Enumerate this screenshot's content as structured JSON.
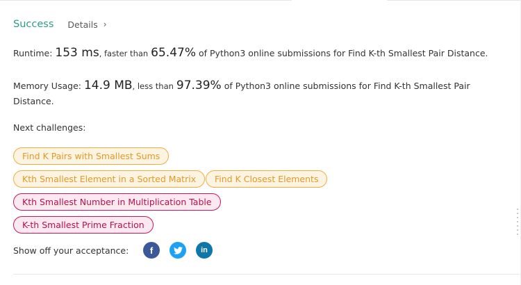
{
  "result": {
    "status": "Success",
    "details_label": "Details",
    "chevron": "›"
  },
  "runtime": {
    "label": "Runtime:",
    "value": "153 ms",
    "comparison": ", faster than",
    "percent": "65.47%",
    "suffix": "of Python3 online submissions for Find K-th Smallest Pair Distance."
  },
  "memory": {
    "label": "Memory Usage:",
    "value": "14.9 MB",
    "comparison": ", less than",
    "percent": "97.39%",
    "suffix": "of Python3 online submissions for Find K-th Smallest Pair Distance."
  },
  "challenges": {
    "label": "Next challenges:",
    "items": [
      {
        "label": "Find K Pairs with Smallest Sums",
        "difficulty": "medium"
      },
      {
        "label": "Kth Smallest Element in a Sorted Matrix",
        "difficulty": "medium"
      },
      {
        "label": "Find K Closest Elements",
        "difficulty": "medium"
      },
      {
        "label": "Kth Smallest Number in Multiplication Table",
        "difficulty": "hard"
      },
      {
        "label": "K-th Smallest Prime Fraction",
        "difficulty": "hard"
      }
    ]
  },
  "share": {
    "label": "Show off your acceptance:",
    "facebook_glyph": "f",
    "linkedin_glyph": "in"
  },
  "colors": {
    "success": "#2c9c8a",
    "medium": "#e09a27",
    "hard": "#b5114f",
    "facebook": "#3b5998",
    "twitter": "#1da1f2",
    "linkedin": "#0e76a8"
  }
}
